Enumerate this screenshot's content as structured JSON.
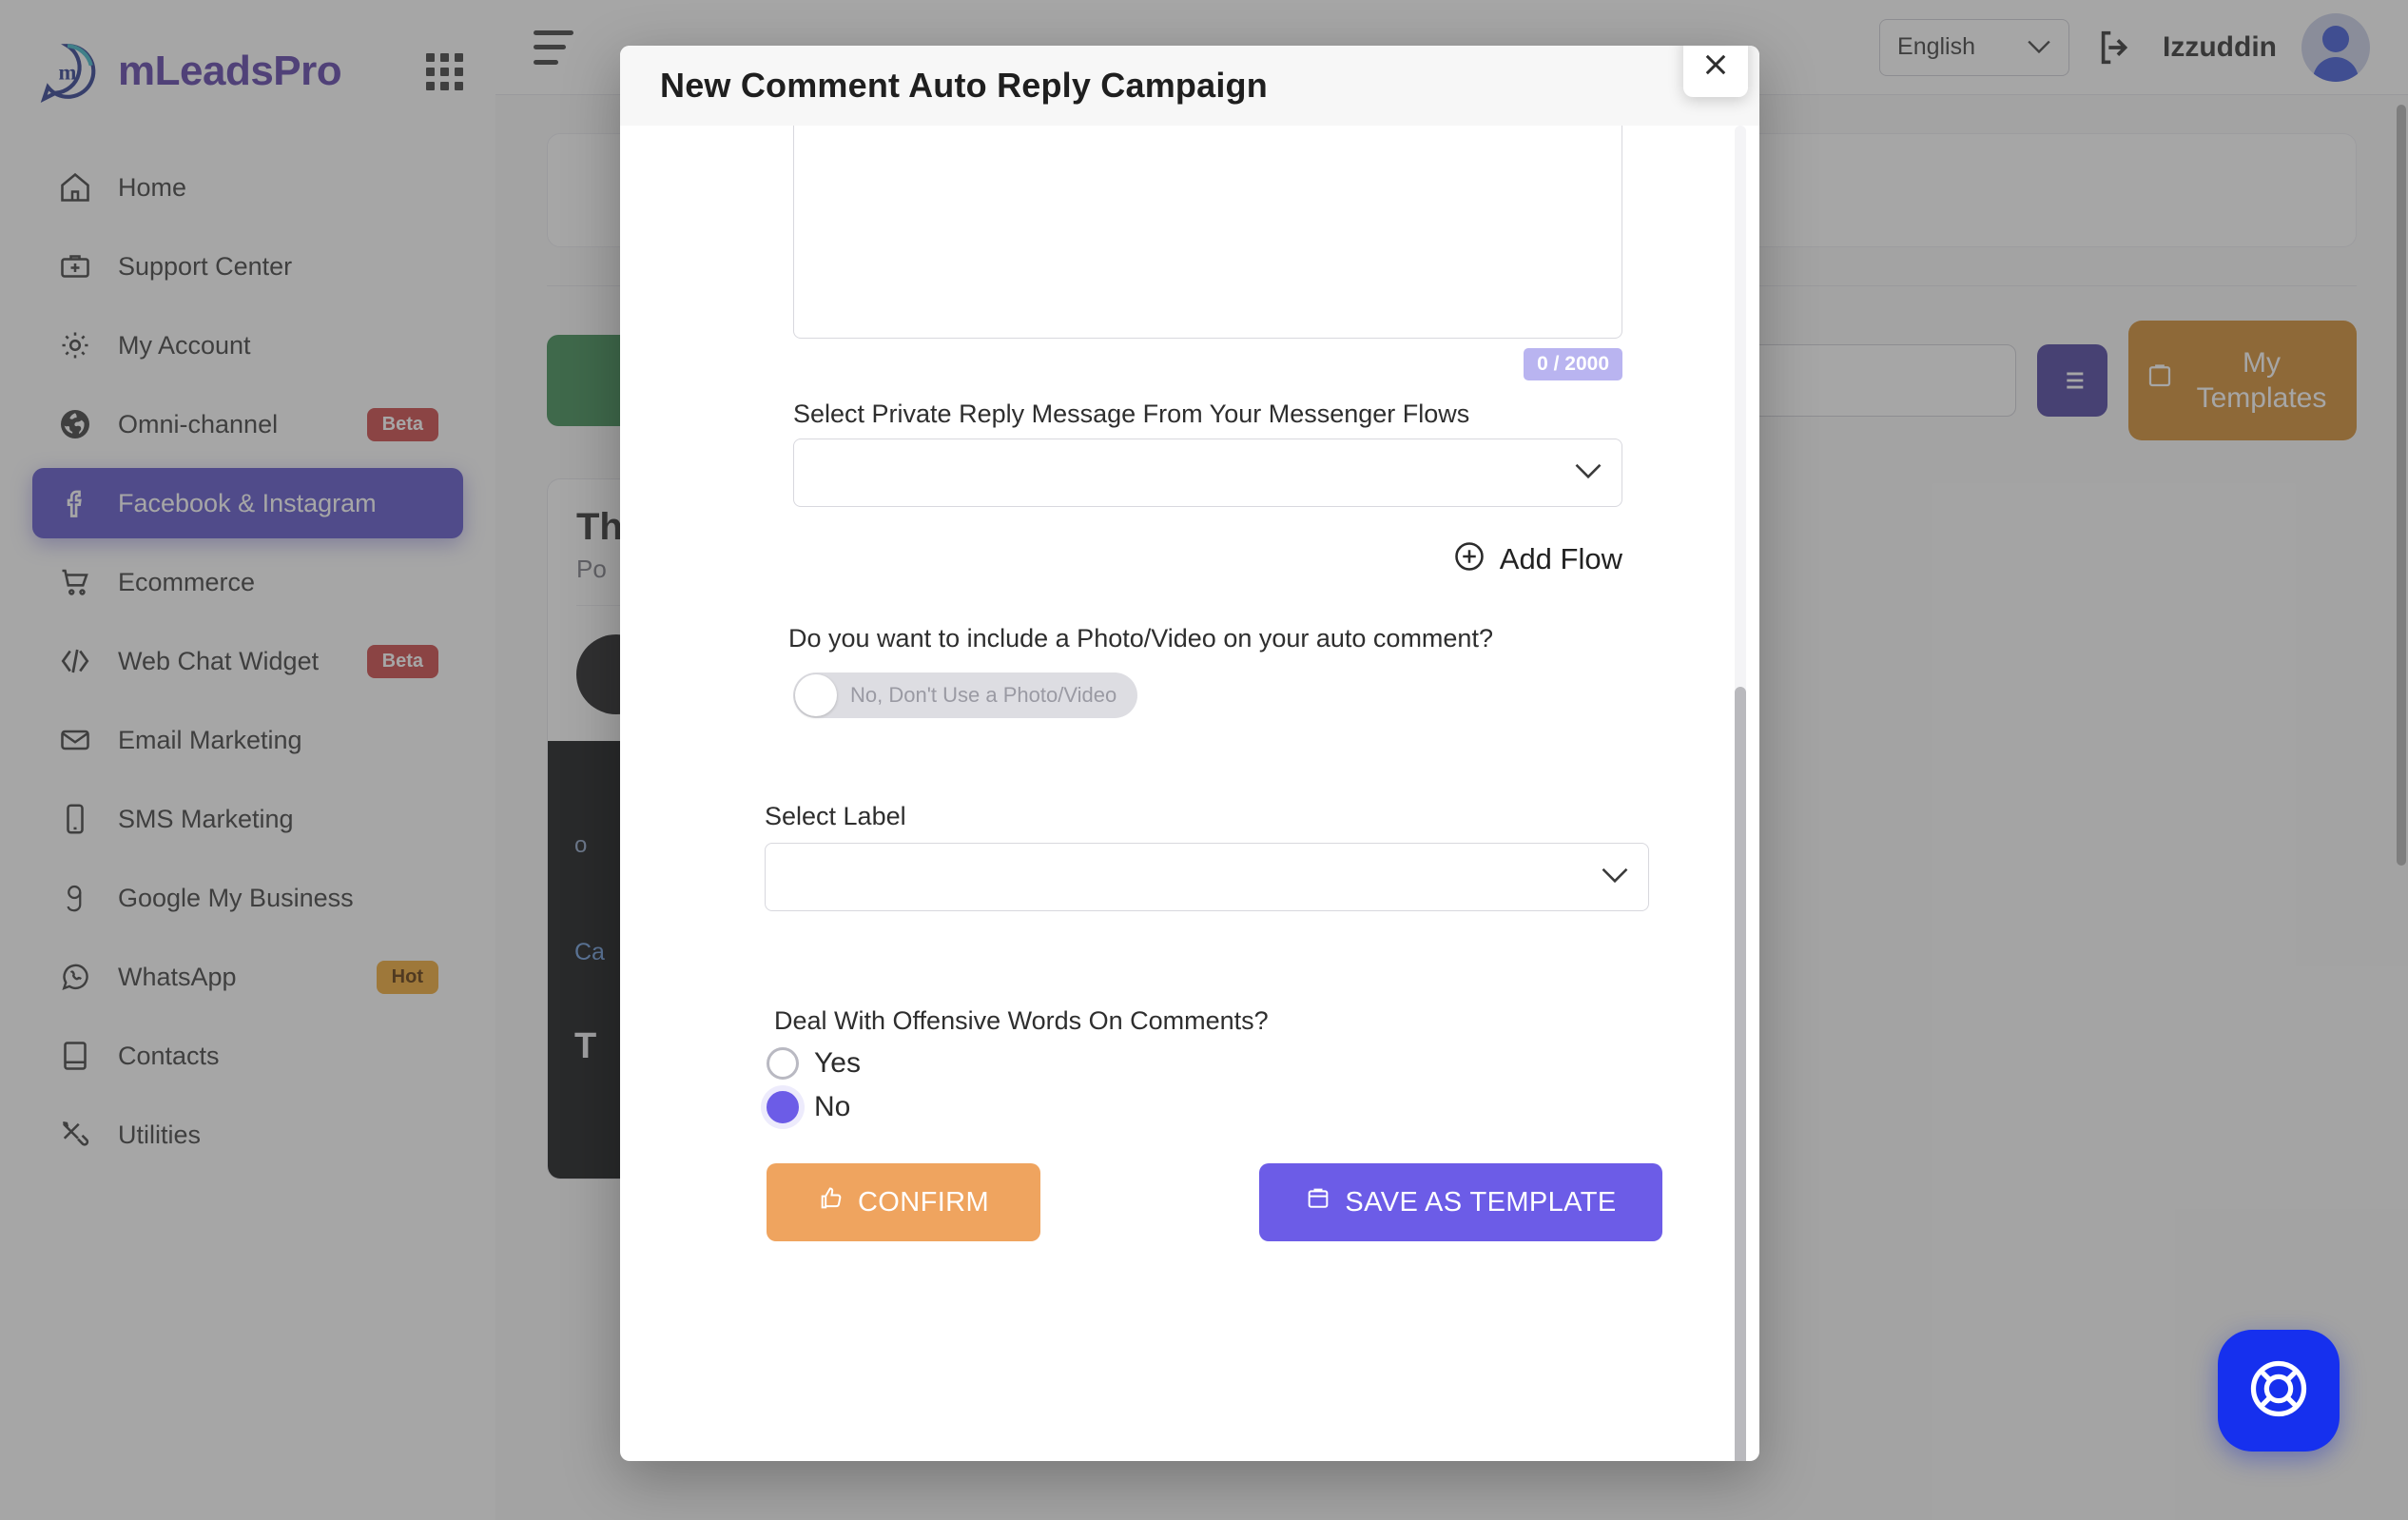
{
  "brand": {
    "name": "mLeadsPro",
    "logo_icon": "mleadspro-logo-icon",
    "apps_icon": "apps-grid-icon"
  },
  "sidebar": {
    "items": [
      {
        "label": "Home",
        "icon": "home-icon",
        "badge": null,
        "active": false
      },
      {
        "label": "Support Center",
        "icon": "briefcase-plus-icon",
        "badge": null,
        "active": false
      },
      {
        "label": "My Account",
        "icon": "gear-icon",
        "badge": null,
        "active": false
      },
      {
        "label": "Omni-channel",
        "icon": "globe-icon",
        "badge": "Beta",
        "badge_type": "beta",
        "active": false
      },
      {
        "label": "Facebook & Instagram",
        "icon": "facebook-icon",
        "badge": null,
        "active": true
      },
      {
        "label": "Ecommerce",
        "icon": "shopping-cart-icon",
        "badge": null,
        "active": false
      },
      {
        "label": "Web Chat Widget",
        "icon": "code-brackets-icon",
        "badge": "Beta",
        "badge_type": "beta",
        "active": false
      },
      {
        "label": "Email Marketing",
        "icon": "envelope-icon",
        "badge": null,
        "active": false
      },
      {
        "label": "SMS Marketing",
        "icon": "mobile-phone-icon",
        "badge": null,
        "active": false
      },
      {
        "label": "Google My Business",
        "icon": "google-g-icon",
        "badge": null,
        "active": false
      },
      {
        "label": "WhatsApp",
        "icon": "whatsapp-icon",
        "badge": "Hot",
        "badge_type": "hot",
        "active": false
      },
      {
        "label": "Contacts",
        "icon": "contact-book-icon",
        "badge": null,
        "active": false
      },
      {
        "label": "Utilities",
        "icon": "tools-icon",
        "badge": null,
        "active": false
      }
    ]
  },
  "topbar": {
    "menu_icon": "hamburger-menu-icon",
    "language": "English",
    "language_chevron_icon": "chevron-down-icon",
    "logout_icon": "logout-arrow-icon",
    "user_name": "Izzuddin",
    "avatar_icon": "user-avatar-icon"
  },
  "background": {
    "templates_button": "My Templates",
    "templates_icon": "clipboard-icon",
    "list_icon": "list-view-icon",
    "post_card": {
      "title": "Th",
      "subtitle": "Po",
      "media_tag": "o",
      "media_caption": "Ca",
      "media_title": "T"
    }
  },
  "modal": {
    "title": "New Comment Auto Reply Campaign",
    "close_icon": "close-x-icon",
    "message_counter": "0 / 2000",
    "flow_label": "Select Private Reply Message From Your Messenger Flows",
    "flow_value": "",
    "flow_chevron_icon": "chevron-down-icon",
    "add_flow_label": "Add Flow",
    "add_flow_icon": "plus-circle-icon",
    "photo_question": "Do you want to include a Photo/Video on your auto comment?",
    "photo_toggle_label": "No, Don't Use a Photo/Video",
    "photo_toggle_on": false,
    "select_label_title": "Select Label",
    "select_label_value": "",
    "select_label_chevron_icon": "chevron-down-icon",
    "offensive_question": "Deal With Offensive Words On Comments?",
    "offensive_options": [
      {
        "label": "Yes",
        "selected": false
      },
      {
        "label": "No",
        "selected": true
      }
    ],
    "confirm_label": "CONFIRM",
    "confirm_icon": "thumbs-up-icon",
    "save_template_label": "SAVE AS TEMPLATE",
    "save_template_icon": "clipboard-icon",
    "scrollbar_icon": "vertical-scrollbar"
  },
  "support": {
    "icon": "lifebuoy-support-icon"
  },
  "colors": {
    "accent_purple": "#6c5ce7",
    "sidebar_active": "#5b52c9",
    "confirm_orange": "#efa45f",
    "templates_orange": "#d28a2c",
    "beta_badge": "#c44444",
    "hot_badge": "#f0a830",
    "support_blue": "#1630ee"
  }
}
